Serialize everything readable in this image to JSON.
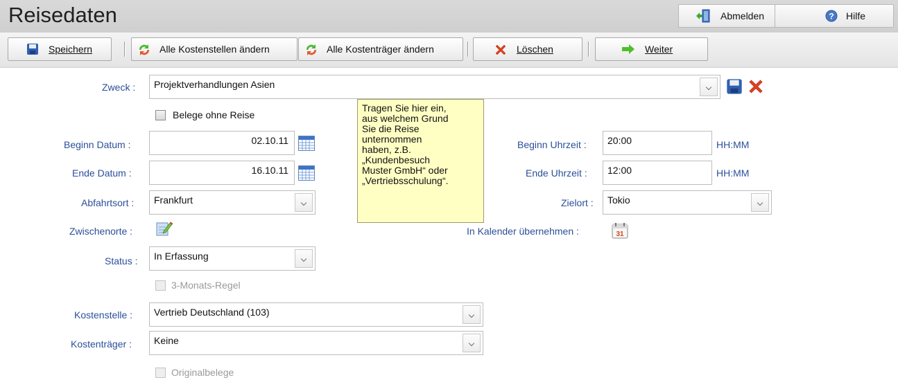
{
  "header": {
    "title": "Reisedaten",
    "logout_label": "Abmelden",
    "help_label": "Hilfe"
  },
  "toolbar": {
    "save_label": "Speichern",
    "change_cost_centers_label": "Alle Kostenstellen ändern",
    "change_cost_units_label": "Alle Kostenträger ändern",
    "delete_label": "Löschen",
    "next_label": "Weiter"
  },
  "form": {
    "purpose": {
      "label": "Zweck :",
      "value": "Projektverhandlungen Asien"
    },
    "receipts_without_trip": {
      "label": "Belege ohne Reise",
      "checked": false
    },
    "start_date": {
      "label": "Beginn Datum :",
      "value": "02.10.11"
    },
    "end_date": {
      "label": "Ende Datum :",
      "value": "16.10.11"
    },
    "start_time": {
      "label": "Beginn Uhrzeit :",
      "value": "20:00",
      "unit": "HH:MM"
    },
    "end_time": {
      "label": "Ende Uhrzeit :",
      "value": "12:00",
      "unit": "HH:MM"
    },
    "departure": {
      "label": "Abfahrtsort :",
      "value": "Frankfurt"
    },
    "destination": {
      "label": "Zielort :",
      "value": "Tokio"
    },
    "stopovers": {
      "label": "Zwischenorte :"
    },
    "calendar": {
      "label": "In Kalender übernehmen :"
    },
    "status": {
      "label": "Status :",
      "value": "In Erfassung"
    },
    "three_month_rule": {
      "label": "3-Monats-Regel",
      "checked": false,
      "disabled": true
    },
    "cost_center": {
      "label": "Kostenstelle :",
      "value": "Vertrieb Deutschland (103)"
    },
    "cost_unit": {
      "label": "Kostenträger :",
      "value": "Keine"
    },
    "original_receipts": {
      "label": "Originalbelege",
      "checked": false,
      "disabled": true
    }
  },
  "tooltip": {
    "lines": [
      "Tragen Sie hier ein,",
      "aus welchem Grund",
      "Sie die Reise",
      "unternommen",
      "haben, z.B.",
      "„Kundenbesuch",
      "Muster GmbH“ oder",
      "„Vertriebsschulung“."
    ]
  },
  "icons": {
    "logout": "exit-door-icon",
    "help": "help-question-icon",
    "save": "floppy-disk-icon",
    "change": "refresh-arrows-icon",
    "delete": "red-x-icon",
    "next": "green-arrow-right-icon",
    "calendar_picker": "calendar-grid-icon",
    "stopovers_edit": "notepad-pencil-icon",
    "calendar_transfer": "calendar-31-icon"
  },
  "colors": {
    "label_blue": "#2b4f9a",
    "tooltip_bg": "#ffffc4",
    "delete_red": "#e0401f",
    "next_green": "#4fbf2a"
  }
}
